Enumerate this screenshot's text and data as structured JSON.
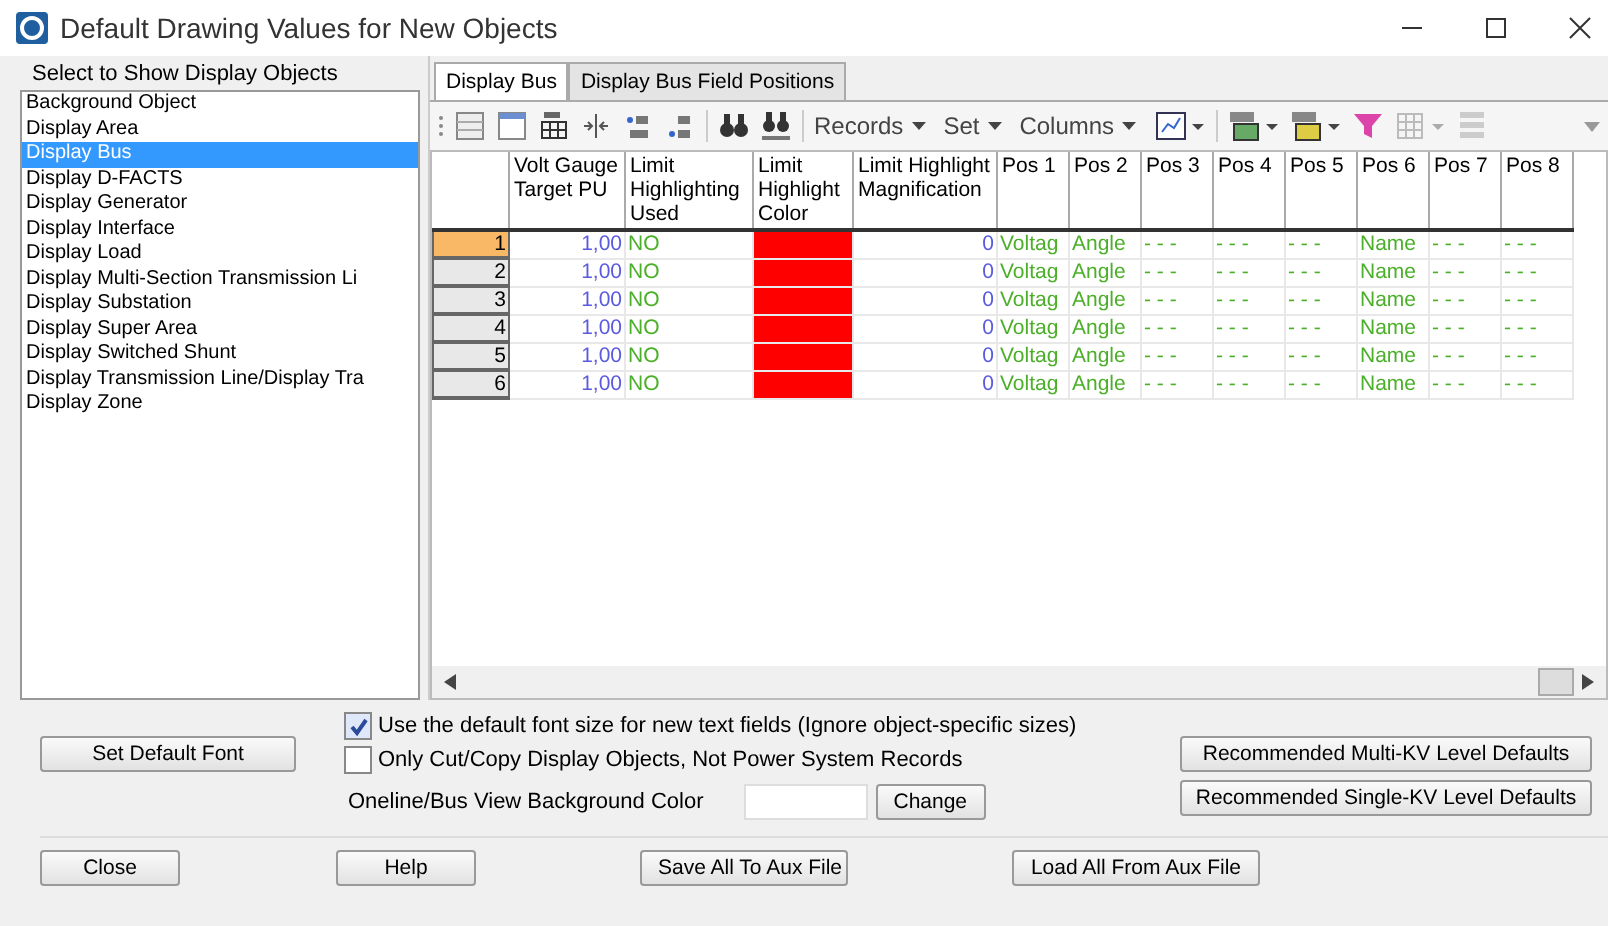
{
  "window": {
    "title": "Default Drawing Values for New Objects"
  },
  "object_list": {
    "label": "Select to Show Display Objects",
    "items": [
      {
        "label": "Background Object",
        "selected": false
      },
      {
        "label": "Display Area",
        "selected": false
      },
      {
        "label": "Display Bus",
        "selected": true
      },
      {
        "label": "Display D-FACTS",
        "selected": false
      },
      {
        "label": "Display Generator",
        "selected": false
      },
      {
        "label": "Display Interface",
        "selected": false
      },
      {
        "label": "Display Load",
        "selected": false
      },
      {
        "label": "Display Multi-Section Transmission Li",
        "selected": false
      },
      {
        "label": "Display Substation",
        "selected": false
      },
      {
        "label": "Display Super Area",
        "selected": false
      },
      {
        "label": "Display Switched Shunt",
        "selected": false
      },
      {
        "label": "Display Transmission Line/Display Tra",
        "selected": false
      },
      {
        "label": "Display Zone",
        "selected": false
      }
    ]
  },
  "tabs": [
    {
      "label": "Display Bus",
      "selected": true
    },
    {
      "label": "Display Bus Field Positions",
      "selected": false
    }
  ],
  "toolbar": {
    "menus": [
      "Records",
      "Set",
      "Columns"
    ]
  },
  "table": {
    "columns": [
      "Volt Gauge Target PU",
      "Limit Highlighting Used",
      "Limit Highlight Color",
      "Limit Highlight Magnification",
      "Pos 1",
      "Pos 2",
      "Pos 3",
      "Pos 4",
      "Pos 5",
      "Pos 6",
      "Pos 7",
      "Pos 8"
    ],
    "rows": [
      {
        "number": "1",
        "selected": true,
        "volt": "1,00",
        "used": "NO",
        "color": "#ff0000",
        "magnification": "0",
        "pos": [
          "Voltag",
          "Angle",
          "- - -",
          "- - -",
          "- - -",
          "Name",
          "- - -",
          "- - -"
        ]
      },
      {
        "number": "2",
        "selected": false,
        "volt": "1,00",
        "used": "NO",
        "color": "#ff0000",
        "magnification": "0",
        "pos": [
          "Voltag",
          "Angle",
          "- - -",
          "- - -",
          "- - -",
          "Name",
          "- - -",
          "- - -"
        ]
      },
      {
        "number": "3",
        "selected": false,
        "volt": "1,00",
        "used": "NO",
        "color": "#ff0000",
        "magnification": "0",
        "pos": [
          "Voltag",
          "Angle",
          "- - -",
          "- - -",
          "- - -",
          "Name",
          "- - -",
          "- - -"
        ]
      },
      {
        "number": "4",
        "selected": false,
        "volt": "1,00",
        "used": "NO",
        "color": "#ff0000",
        "magnification": "0",
        "pos": [
          "Voltag",
          "Angle",
          "- - -",
          "- - -",
          "- - -",
          "Name",
          "- - -",
          "- - -"
        ]
      },
      {
        "number": "5",
        "selected": false,
        "volt": "1,00",
        "used": "NO",
        "color": "#ff0000",
        "magnification": "0",
        "pos": [
          "Voltag",
          "Angle",
          "- - -",
          "- - -",
          "- - -",
          "Name",
          "- - -",
          "- - -"
        ]
      },
      {
        "number": "6",
        "selected": false,
        "volt": "1,00",
        "used": "NO",
        "color": "#ff0000",
        "magnification": "0",
        "pos": [
          "Voltag",
          "Angle",
          "- - -",
          "- - -",
          "- - -",
          "Name",
          "- - -",
          "- - -"
        ]
      }
    ]
  },
  "set_default_font_button": "Set Default Font",
  "checkboxes": [
    {
      "label": "Use the default font size for new text fields (Ignore object-specific sizes)",
      "checked": true
    },
    {
      "label": "Only Cut/Copy Display Objects, Not Power System Records",
      "checked": false
    }
  ],
  "background_color": {
    "label": "Oneline/Bus View Background Color",
    "button": "Change"
  },
  "defaults_buttons": [
    "Recommended Multi-KV Level Defaults",
    "Recommended Single-KV Level Defaults"
  ],
  "footer_buttons": [
    "Close",
    "Help",
    "Save All To Aux File",
    "Load All From Aux File"
  ]
}
